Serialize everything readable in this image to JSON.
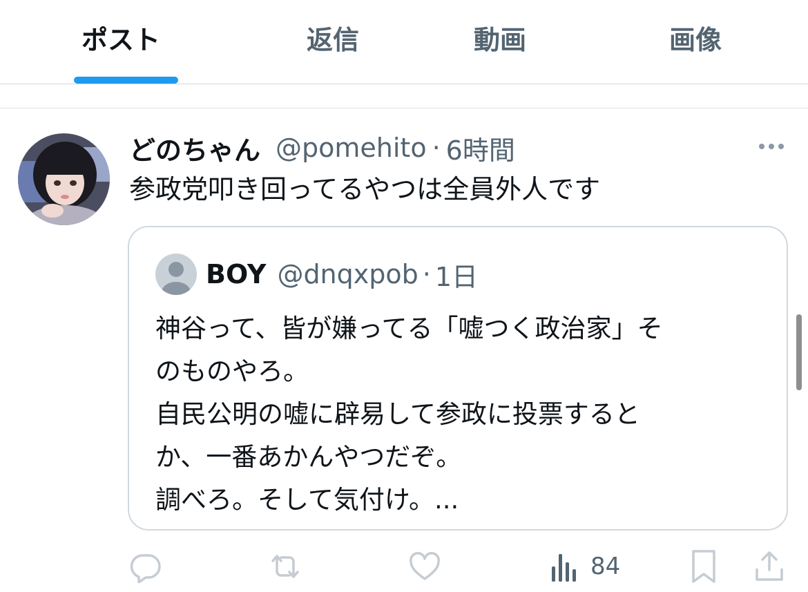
{
  "tabs": [
    {
      "label": "ポスト",
      "active": true
    },
    {
      "label": "返信",
      "active": false
    },
    {
      "label": "動画",
      "active": false
    },
    {
      "label": "画像",
      "active": false
    }
  ],
  "post": {
    "display_name": "どのちゃん",
    "handle": "@pomehito",
    "separator": "·",
    "time": "6時間",
    "text": "参政党叩き回ってるやつは全員外人です",
    "quote": {
      "display_name": "BOY",
      "handle": "@dnqxpob",
      "separator": "·",
      "time": "1日",
      "lines": [
        "神谷って、皆が嫌ってる「嘘つく政治家」そ",
        "のものやろ。",
        "自民公明の嘘に辟易して参政に投票すると",
        "か、一番あかんやつだぞ。",
        "調べろ。そして気付け。..."
      ]
    },
    "actions": {
      "views_count": "84"
    }
  },
  "colors": {
    "accent": "#1d9bf0",
    "text_primary": "#0f1419",
    "text_secondary": "#536471",
    "border": "#cfd9de",
    "icon_gray": "#c5ccd2"
  }
}
